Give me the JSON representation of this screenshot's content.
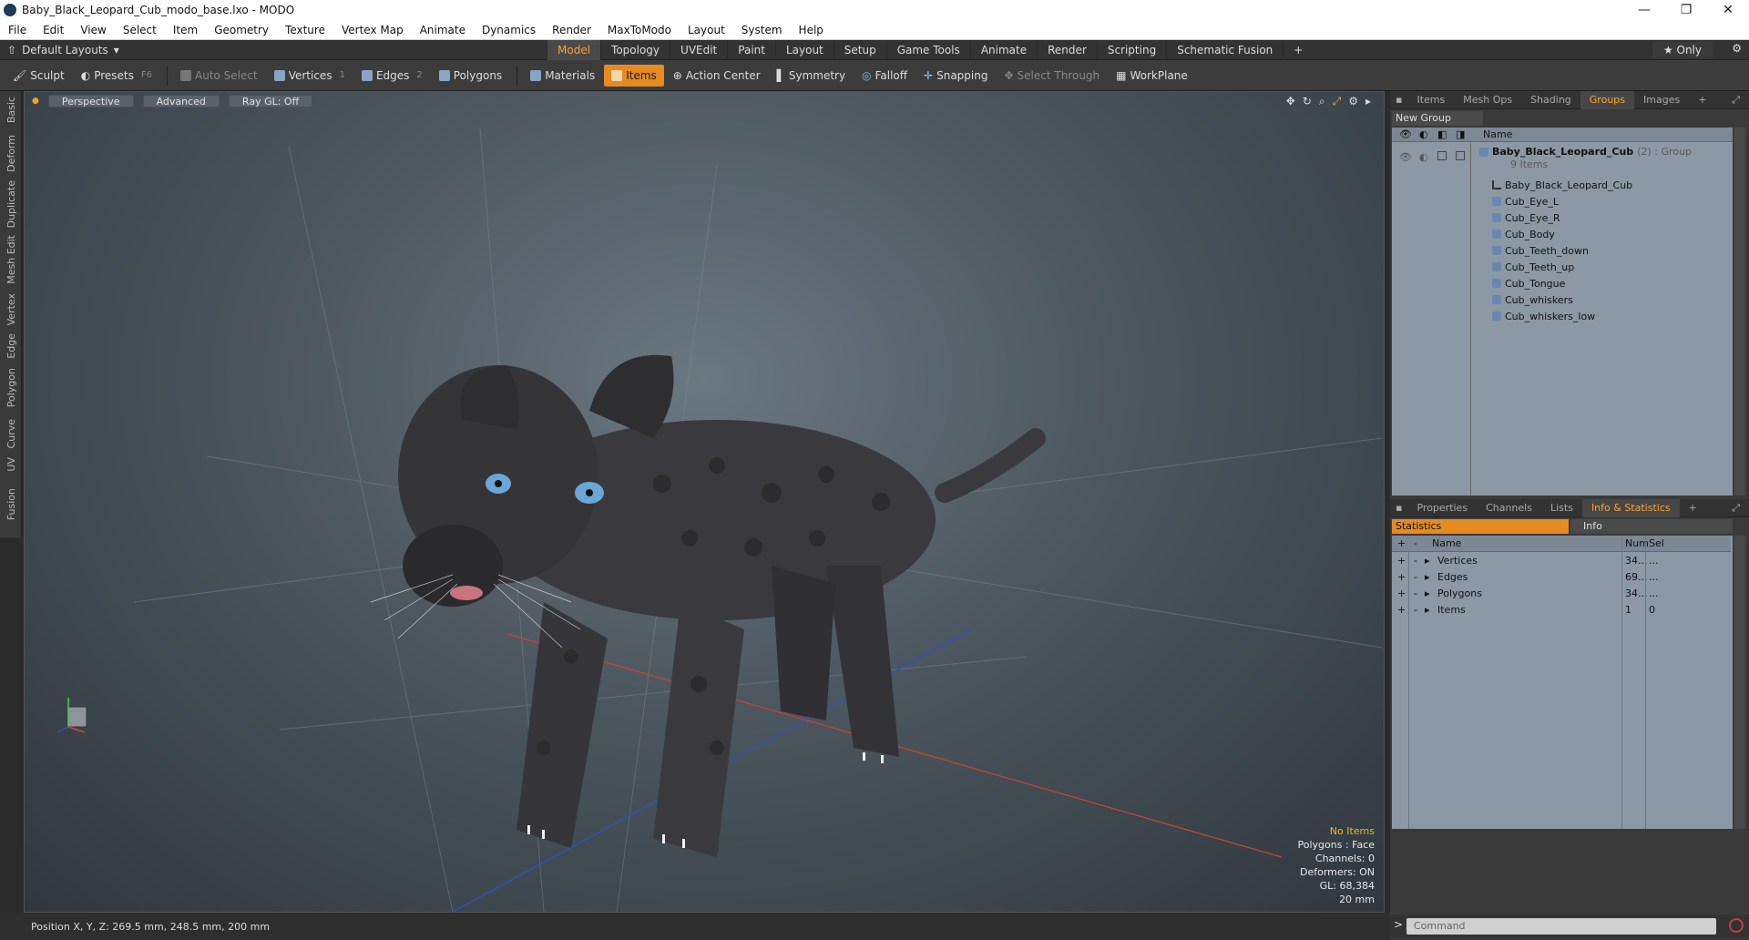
{
  "titlebar": {
    "title": "Baby_Black_Leopard_Cub_modo_base.lxo - MODO",
    "minimize": "—",
    "maximize": "❐",
    "close": "✕"
  },
  "menu": [
    "File",
    "Edit",
    "View",
    "Select",
    "Item",
    "Geometry",
    "Texture",
    "Vertex Map",
    "Animate",
    "Dynamics",
    "Render",
    "MaxToModo",
    "Layout",
    "System",
    "Help"
  ],
  "layoutbar": {
    "layout_selector": "Default Layouts",
    "tabs": [
      "Model",
      "Topology",
      "UVEdit",
      "Paint",
      "Layout",
      "Setup",
      "Game Tools",
      "Animate",
      "Render",
      "Scripting",
      "Schematic Fusion"
    ],
    "active_tab": "Model",
    "only_label": "★ Only"
  },
  "toolbar": {
    "sculpt": "Sculpt",
    "presets": "Presets",
    "presets_key": "F6",
    "auto_select": "Auto Select",
    "vertices": "Vertices",
    "vertices_count": "1",
    "edges": "Edges",
    "edges_count": "2",
    "polygons": "Polygons",
    "materials": "Materials",
    "items": "Items",
    "action_center": "Action Center",
    "symmetry": "Symmetry",
    "falloff": "Falloff",
    "snapping": "Snapping",
    "select_through": "Select Through",
    "workplane": "WorkPlane"
  },
  "lefttabs": [
    "Basic",
    "Deform",
    "Duplicate",
    "Mesh Edit",
    "Vertex",
    "Edge",
    "Polygon",
    "Curve",
    "UV",
    "Fusion"
  ],
  "viewport": {
    "view_mode": "Perspective",
    "shading": "Advanced",
    "raygl": "Ray GL: Off",
    "info": {
      "no_items": "No Items",
      "polygons": "Polygons : Face",
      "channels": "Channels: 0",
      "deformers": "Deformers: ON",
      "gl": "GL: 68,384",
      "scale": "20 mm"
    }
  },
  "status": {
    "position": "Position X, Y, Z:   269.5 mm, 248.5 mm, 200 mm"
  },
  "top_panel": {
    "tabs": [
      "Items",
      "Mesh Ops",
      "Shading",
      "Groups",
      "Images"
    ],
    "active_tab": "Groups",
    "new_group": "New Group",
    "col_name": "Name",
    "group": {
      "name": "Baby_Black_Leopard_Cub",
      "suffix": "(2) : Group",
      "count": "9 Items"
    },
    "items": [
      "Baby_Black_Leopard_Cub",
      "Cub_Eye_L",
      "Cub_Eye_R",
      "Cub_Body",
      "Cub_Teeth_down",
      "Cub_Teeth_up",
      "Cub_Tongue",
      "Cub_whiskers",
      "Cub_whiskers_low"
    ]
  },
  "bottom_panel": {
    "tabs": [
      "Properties",
      "Channels",
      "Lists",
      "Info & Statistics"
    ],
    "active_tab": "Info & Statistics",
    "subtabs": {
      "statistics": "Statistics",
      "info": "Info"
    },
    "cols": {
      "name": "Name",
      "num": "Num",
      "sel": "Sel"
    },
    "rows": [
      {
        "name": "Vertices",
        "num": "34...",
        "sel": "..."
      },
      {
        "name": "Edges",
        "num": "69...",
        "sel": "..."
      },
      {
        "name": "Polygons",
        "num": "34...",
        "sel": "..."
      },
      {
        "name": "Items",
        "num": "1",
        "sel": "0"
      }
    ]
  },
  "command": {
    "placeholder": "Command"
  }
}
